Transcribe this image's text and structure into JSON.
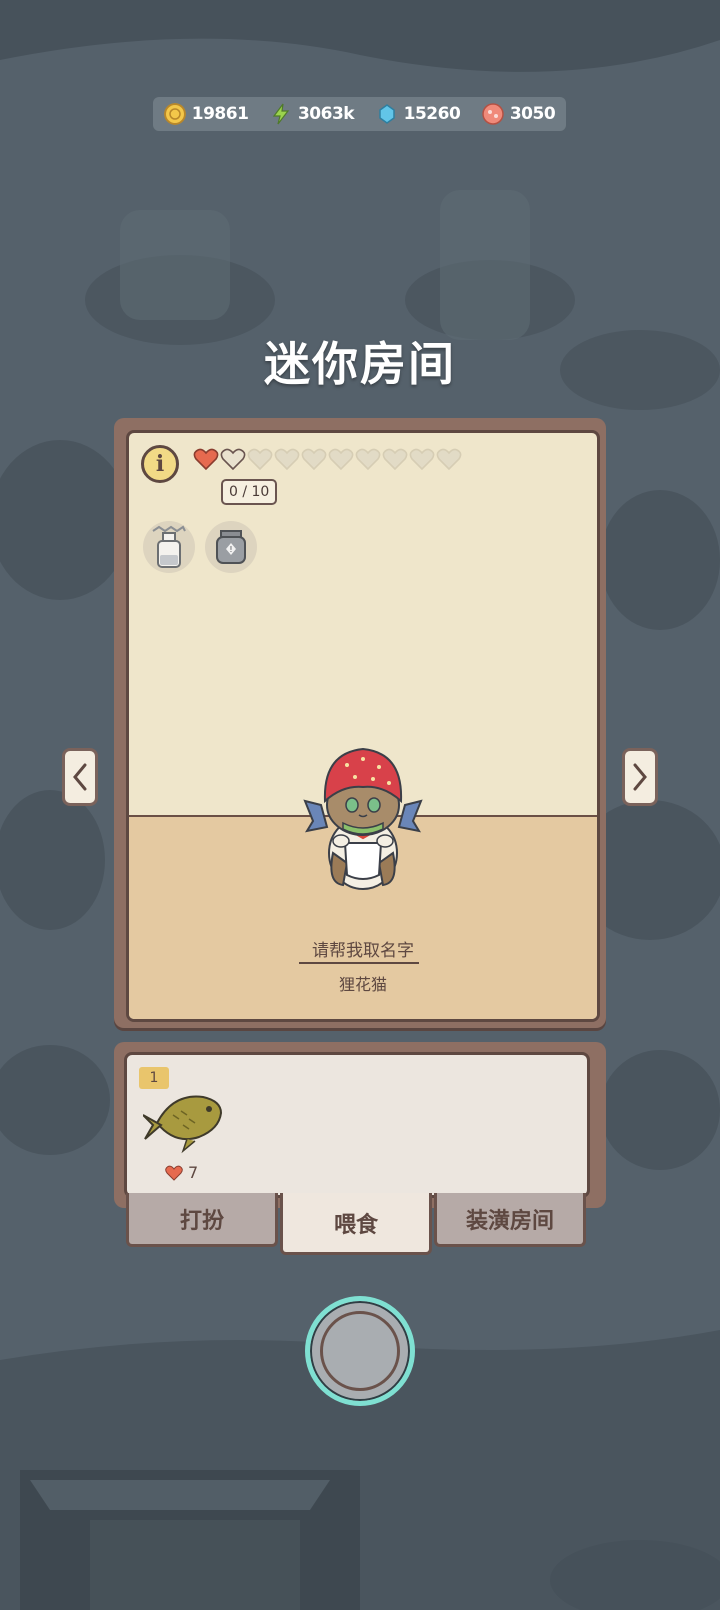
{
  "currencies": [
    {
      "name": "gold-coin",
      "icon": "coin-icon",
      "value": "19861",
      "color": "#f3c74a"
    },
    {
      "name": "energy",
      "icon": "lightning-icon",
      "value": "3063k",
      "color": "#9bd34d"
    },
    {
      "name": "crystal",
      "icon": "crystal-icon",
      "value": "15260",
      "color": "#62c5e8"
    },
    {
      "name": "shell",
      "icon": "shell-icon",
      "value": "3050",
      "color": "#f08a7a"
    }
  ],
  "title": "迷你房间",
  "room": {
    "hearts_total": 10,
    "hearts_filled": 1,
    "affection": "0 / 10",
    "name_prompt": "请帮我取名字",
    "cat_type": "狸花猫",
    "status_icons": [
      "milk-bottle-icon",
      "jar-icon"
    ]
  },
  "food": {
    "items": [
      {
        "icon": "fish-icon",
        "count": "1",
        "cost": "7"
      }
    ]
  },
  "tabs": [
    {
      "label": "打扮",
      "active": false
    },
    {
      "label": "喂食",
      "active": true
    },
    {
      "label": "装潢房间",
      "active": false
    }
  ],
  "colors": {
    "background": "#55616b",
    "panel_frame": "#8e6f63",
    "panel_wall": "#efe6cb",
    "panel_floor": "#e4c9a1",
    "heart_red": "#e66a4f",
    "action_ring": "#7fe0d2"
  }
}
